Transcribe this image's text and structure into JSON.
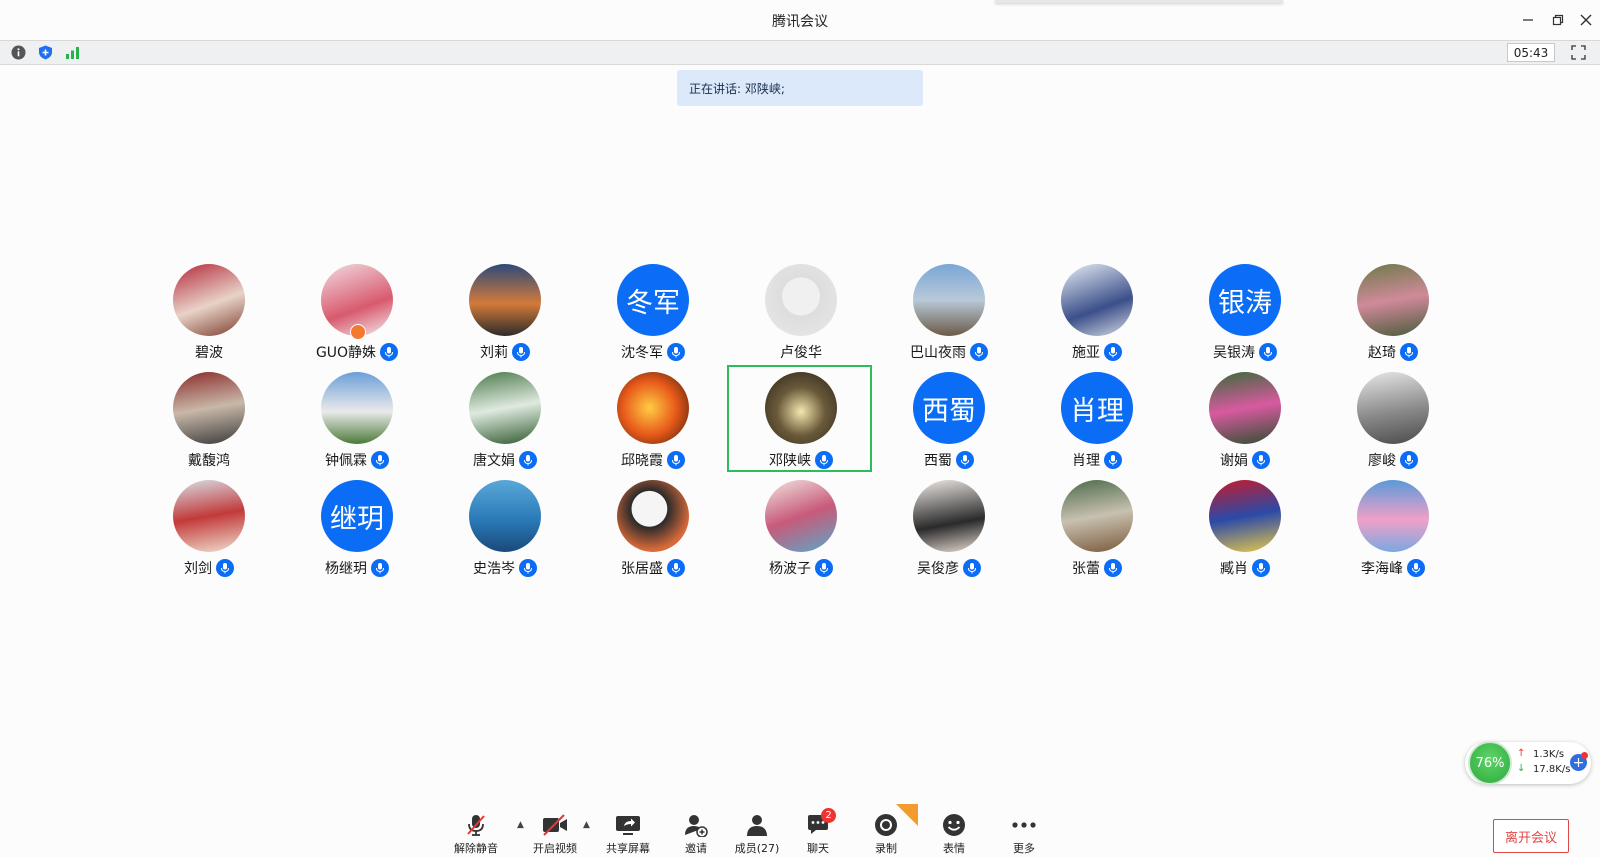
{
  "window": {
    "title": "腾讯会议",
    "controls": [
      "minimize-icon",
      "restore-icon",
      "close-icon"
    ]
  },
  "infobar": {
    "icons": [
      "info-icon",
      "shield-icon",
      "signal-icon"
    ],
    "timer": "05:43"
  },
  "speaking": {
    "text": "正在讲话: 邓陕峡;"
  },
  "participants": [
    {
      "name": "碧波",
      "mic": false
    },
    {
      "name": "GUO静姝",
      "mic": true
    },
    {
      "name": "刘莉",
      "mic": true
    },
    {
      "name": "沈冬军",
      "mic": true,
      "avatar_text": "冬军"
    },
    {
      "name": "卢俊华",
      "mic": false
    },
    {
      "name": "巴山夜雨",
      "mic": true
    },
    {
      "name": "施亚",
      "mic": true
    },
    {
      "name": "吴银涛",
      "mic": true,
      "avatar_text": "银涛"
    },
    {
      "name": "赵琦",
      "mic": true
    },
    {
      "name": "戴馥鸿",
      "mic": false
    },
    {
      "name": "钟佩霖",
      "mic": true
    },
    {
      "name": "唐文娟",
      "mic": true
    },
    {
      "name": "邱晓霞",
      "mic": true
    },
    {
      "name": "邓陕峡",
      "mic": true,
      "speaking": true
    },
    {
      "name": "西蜀",
      "mic": true,
      "avatar_text": "西蜀"
    },
    {
      "name": "肖理",
      "mic": true,
      "avatar_text": "肖理"
    },
    {
      "name": "谢娟",
      "mic": true
    },
    {
      "name": "廖峻",
      "mic": true
    },
    {
      "name": "刘剑",
      "mic": true
    },
    {
      "name": "杨继玥",
      "mic": true,
      "avatar_text": "继玥"
    },
    {
      "name": "史浩岑",
      "mic": true
    },
    {
      "name": "张居盛",
      "mic": true
    },
    {
      "name": "杨波子",
      "mic": true
    },
    {
      "name": "吴俊彦",
      "mic": true
    },
    {
      "name": "张蕾",
      "mic": true
    },
    {
      "name": "臧肖",
      "mic": true
    },
    {
      "name": "李海峰",
      "mic": true
    }
  ],
  "toolbar": {
    "unmute": "解除静音",
    "video": "开启视频",
    "share": "共享屏幕",
    "invite": "邀请",
    "members": "成员(27)",
    "chat": "聊天",
    "chat_badge": "2",
    "record": "录制",
    "reaction": "表情",
    "more": "更多",
    "leave": "离开会议"
  },
  "network": {
    "percent": "76%",
    "up": "1.3K/s",
    "down": "17.8K/s"
  },
  "colors": {
    "accent": "#0b6df6",
    "speaking_frame": "#2dbb5e",
    "leave": "#e04747"
  }
}
